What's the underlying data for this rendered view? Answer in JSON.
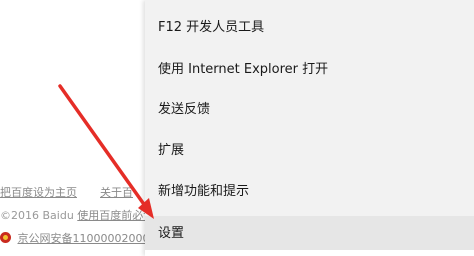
{
  "background_page": {
    "footer_links": [
      "把百度设为主页",
      "关于百"
    ],
    "copyright_text": "©2016 Baidu",
    "terms_link": "使用百度前必读",
    "police_record": "京公网安备11000002000"
  },
  "context_menu": {
    "items": [
      {
        "label": "F12 开发人员工具"
      },
      {
        "label": "使用 Internet Explorer 打开"
      },
      {
        "label": "发送反馈"
      },
      {
        "label": "扩展"
      },
      {
        "label": "新增功能和提示"
      },
      {
        "label": "设置",
        "selected": true
      }
    ]
  },
  "annotation": {
    "type": "arrow",
    "color": "#e52d27",
    "points_to": "设置"
  }
}
